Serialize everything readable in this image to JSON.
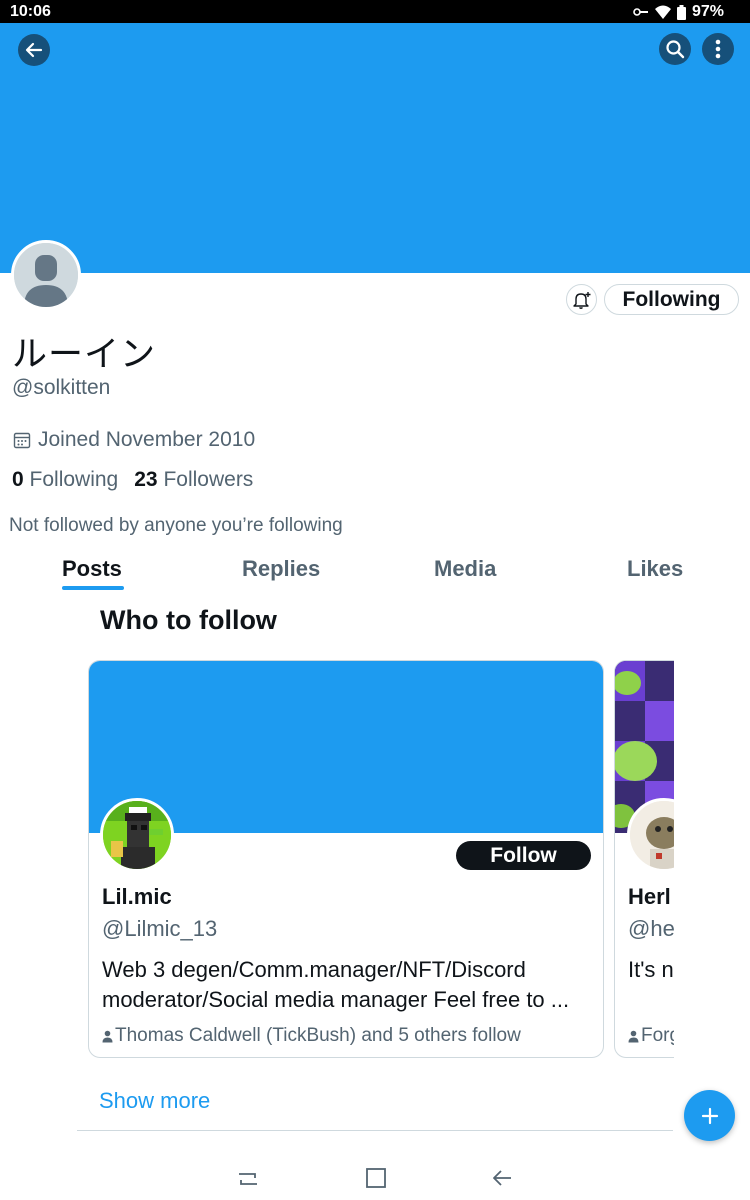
{
  "status_bar": {
    "time": "10:06",
    "battery": "97%"
  },
  "profile": {
    "display_name": "ルーイン",
    "handle": "@solkitten",
    "joined": "Joined November 2010",
    "following_count": "0",
    "following_label": "Following",
    "followers_count": "23",
    "followers_label": "Followers",
    "not_followed": "Not followed by anyone you’re following",
    "following_button": "Following"
  },
  "tabs": [
    {
      "label": "Posts",
      "active": true
    },
    {
      "label": "Replies",
      "active": false
    },
    {
      "label": "Media",
      "active": false
    },
    {
      "label": "Likes",
      "active": false
    }
  ],
  "who_to_follow": {
    "title": "Who to follow",
    "cards": [
      {
        "name": "Lil.mic",
        "handle": "@Lilmic_13",
        "bio": "Web 3 degen/Comm.manager/NFT/Discord moderator/Social media manager Feel free to ...",
        "social_context": "Thomas Caldwell (TickBush) and 5 others follow",
        "follow_label": "Follow"
      },
      {
        "name": "Herl",
        "handle": "@he",
        "bio": "It's n",
        "social_context": "Forg"
      }
    ],
    "show_more": "Show more"
  },
  "colors": {
    "accent": "#1d9bf0",
    "text_primary": "#0f1419",
    "text_secondary": "#536471",
    "border": "#cfd9de"
  },
  "icons": [
    "back-arrow-icon",
    "search-icon",
    "more-vertical-icon",
    "bell-plus-icon",
    "calendar-icon",
    "person-icon",
    "plus-icon",
    "recents-icon",
    "home-square-icon",
    "nav-back-icon"
  ]
}
